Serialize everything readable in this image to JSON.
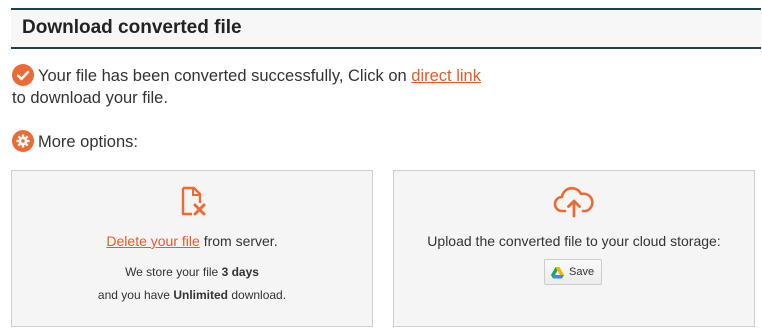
{
  "header": {
    "title": "Download converted file"
  },
  "success": {
    "text_before": "Your file has been converted successfully, Click on",
    "link_text": "direct link",
    "text_after": "to download your file."
  },
  "more_options": {
    "label": "More options:"
  },
  "delete_panel": {
    "link_text": "Delete your file",
    "text_after": "from server.",
    "store_prefix": "We store your file",
    "store_days": "3 days",
    "download_prefix": "and you have",
    "download_value": "Unlimited",
    "download_suffix": "download."
  },
  "upload_panel": {
    "text": "Upload the converted file to your cloud storage:",
    "save_label": "Save"
  },
  "colors": {
    "accent": "#ec6a34",
    "header_border": "#1f3f4f"
  },
  "icons": [
    "check-icon",
    "gear-icon",
    "delete-file-icon",
    "cloud-upload-icon",
    "google-drive-icon"
  ]
}
